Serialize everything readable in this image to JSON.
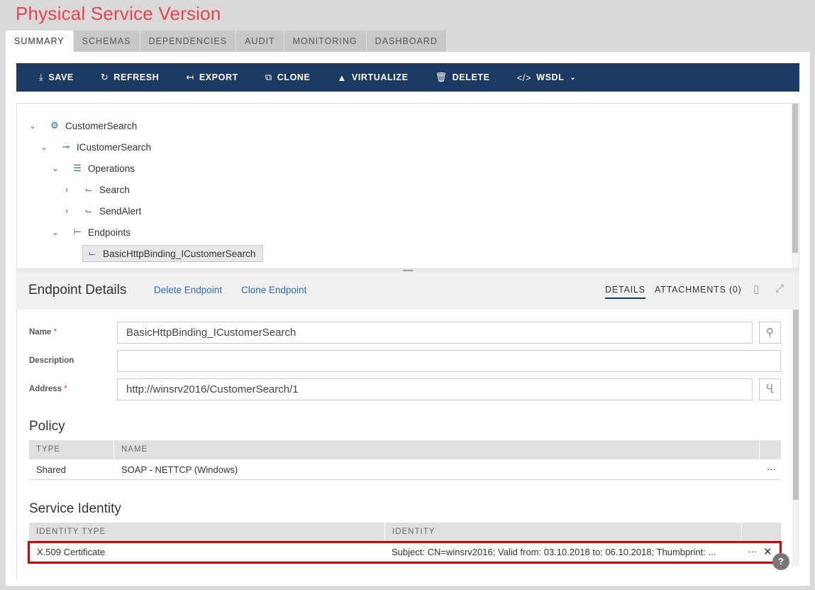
{
  "page": {
    "title": "Physical Service Version"
  },
  "tabs": [
    {
      "label": "SUMMARY"
    },
    {
      "label": "SCHEMAS"
    },
    {
      "label": "DEPENDENCIES"
    },
    {
      "label": "AUDIT"
    },
    {
      "label": "MONITORING"
    },
    {
      "label": "DASHBOARD"
    }
  ],
  "toolbar": {
    "save": "SAVE",
    "refresh": "REFRESH",
    "export": "EXPORT",
    "clone": "CLONE",
    "virtualize": "VIRTUALIZE",
    "delete": "DELETE",
    "wsdl": "WSDL"
  },
  "tree": {
    "service": "CustomerSearch",
    "contract": "ICustomerSearch",
    "operations": "Operations",
    "op_search": "Search",
    "op_sendalert": "SendAlert",
    "endpoints": "Endpoints",
    "endpoint": "BasicHttpBinding_ICustomerSearch"
  },
  "details": {
    "title": "Endpoint Details",
    "delete_link": "Delete Endpoint",
    "clone_link": "Clone Endpoint",
    "tab_details": "DETAILS",
    "tab_attachments": "ATTACHMENTS (0)"
  },
  "form": {
    "name_label": "Name",
    "name_value": "BasicHttpBinding_ICustomerSearch",
    "description_label": "Description",
    "description_value": "",
    "address_label": "Address",
    "address_value": "http://winsrv2016/CustomerSearch/1",
    "required_mark": "*"
  },
  "policy": {
    "title": "Policy",
    "headers": [
      "TYPE",
      "NAME"
    ],
    "rows": [
      {
        "type": "Shared",
        "name": "SOAP - NETTCP (Windows)"
      }
    ]
  },
  "identity": {
    "title": "Service Identity",
    "headers": [
      "IDENTITY TYPE",
      "IDENTITY"
    ],
    "rows": [
      {
        "type": "X.509 Certificate",
        "identity": "Subject: CN=winsrv2016; Valid from: 03.10.2018 to: 06.10.2018; Thumbprint: ..."
      }
    ]
  },
  "colors": {
    "title": "#e0454f",
    "toolbar": "#1d3a65",
    "link": "#2a6ebb",
    "highlight": "#e00000"
  }
}
